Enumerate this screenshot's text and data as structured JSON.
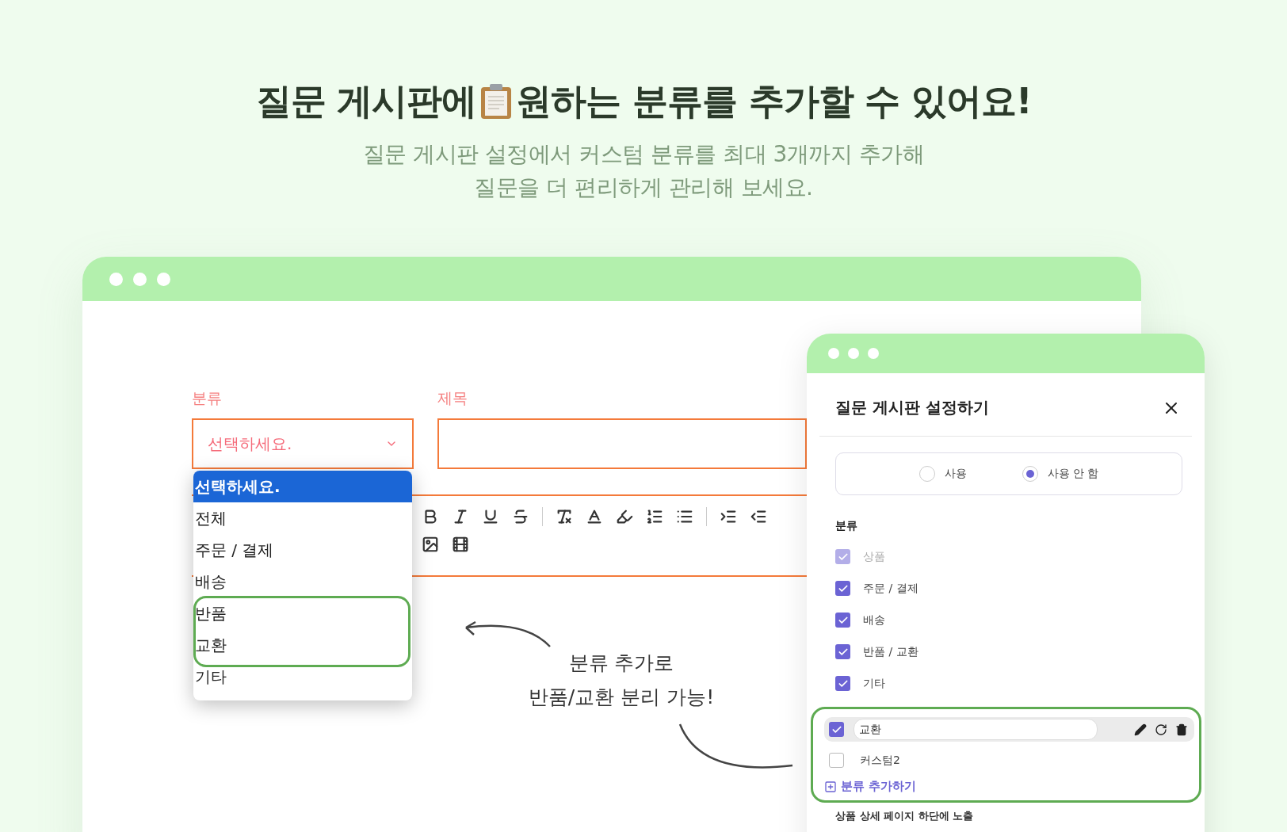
{
  "heading": {
    "before": "질문 게시판에",
    "after": "원하는 분류를 추가할 수 있어요!"
  },
  "subtitle": [
    "질문 게시판 설정에서 커스텀 분류를 최대 3개까지 추가해",
    "질문을 더 편리하게 관리해 보세요."
  ],
  "main_window": {
    "category_label": "분류",
    "select": {
      "value": "선택하세요."
    },
    "title_label": "제목",
    "dropdown": [
      {
        "label": "선택하세요.",
        "selected": true
      },
      {
        "label": "전체",
        "selected": false
      },
      {
        "label": "주문 / 결제",
        "selected": false
      },
      {
        "label": "배송",
        "selected": false
      },
      {
        "label": "반품",
        "selected": false
      },
      {
        "label": "교환",
        "selected": false
      },
      {
        "label": "기타",
        "selected": false
      }
    ],
    "annotation": [
      "분류 추가로",
      "반품/교환 분리 가능!"
    ]
  },
  "settings_panel": {
    "title": "질문 게시판 설정하기",
    "radios": [
      {
        "label": "사용",
        "selected": false
      },
      {
        "label": "사용 안 함",
        "selected": true
      }
    ],
    "section_label": "분류",
    "categories": [
      {
        "label": "상품",
        "checked": true,
        "disabled": true
      },
      {
        "label": "주문 / 결제",
        "checked": true,
        "disabled": false
      },
      {
        "label": "배송",
        "checked": true,
        "disabled": false
      },
      {
        "label": "반품 / 교환",
        "checked": true,
        "disabled": false
      },
      {
        "label": "기타",
        "checked": true,
        "disabled": false
      }
    ],
    "custom_items": [
      {
        "kind": "editing",
        "value": "교환",
        "checked": true
      },
      {
        "kind": "plain",
        "label": "커스텀2",
        "checked": false
      }
    ],
    "add_button": "분류 추가하기",
    "footer_label": "상품 상세 페이지 하단에 노출"
  }
}
